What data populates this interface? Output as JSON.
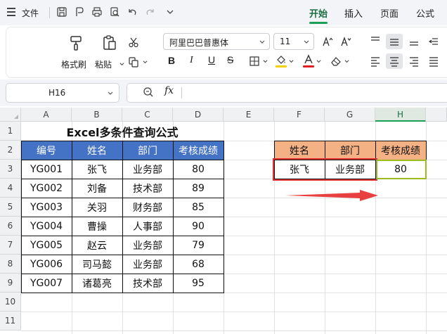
{
  "menubar": {
    "file_label": "文件",
    "tabs": [
      {
        "label": "开始",
        "active": true
      },
      {
        "label": "插入",
        "active": false
      },
      {
        "label": "页面",
        "active": false
      },
      {
        "label": "公式",
        "active": false
      }
    ]
  },
  "ribbon": {
    "format_painter_label": "格式刷",
    "paste_label": "粘贴",
    "font_name": "阿里巴巴普惠体",
    "font_size": "11",
    "bold_label": "B",
    "italic_label": "I",
    "underline_label": "U",
    "strike_label": "S",
    "highlight_color": "#f5d000",
    "font_color": "#e02020"
  },
  "formula_bar": {
    "cell_ref": "H16",
    "fx_label": "fx",
    "formula": ""
  },
  "sheet": {
    "columns": [
      "A",
      "B",
      "C",
      "D",
      "E",
      "F",
      "G",
      "H"
    ],
    "selected_column": "H",
    "rows": [
      "1",
      "2",
      "3",
      "4",
      "5",
      "6",
      "7",
      "8",
      "9",
      "10",
      "11"
    ],
    "title": "Excel多条件查询公式",
    "table_headers": [
      "编号",
      "姓名",
      "部门",
      "考核成绩"
    ],
    "table_rows": [
      [
        "YG001",
        "张飞",
        "业务部",
        "80"
      ],
      [
        "YG002",
        "刘备",
        "技术部",
        "89"
      ],
      [
        "YG003",
        "关羽",
        "财务部",
        "85"
      ],
      [
        "YG004",
        "曹操",
        "人事部",
        "90"
      ],
      [
        "YG005",
        "赵云",
        "业务部",
        "79"
      ],
      [
        "YG006",
        "司马懿",
        "业务部",
        "68"
      ],
      [
        "YG007",
        "诸葛亮",
        "技术部",
        "95"
      ]
    ],
    "lookup_headers": [
      "姓名",
      "部门",
      "考核成绩"
    ],
    "lookup_values": [
      "张飞",
      "业务部",
      "80"
    ],
    "colors": {
      "header_blue": "#4472c4",
      "header_orange": "#f4b183",
      "criteria_box": "#e03030",
      "result_box": "#9bbb1e",
      "arrow": "#e84040",
      "accent_green": "#1b9e55"
    }
  }
}
